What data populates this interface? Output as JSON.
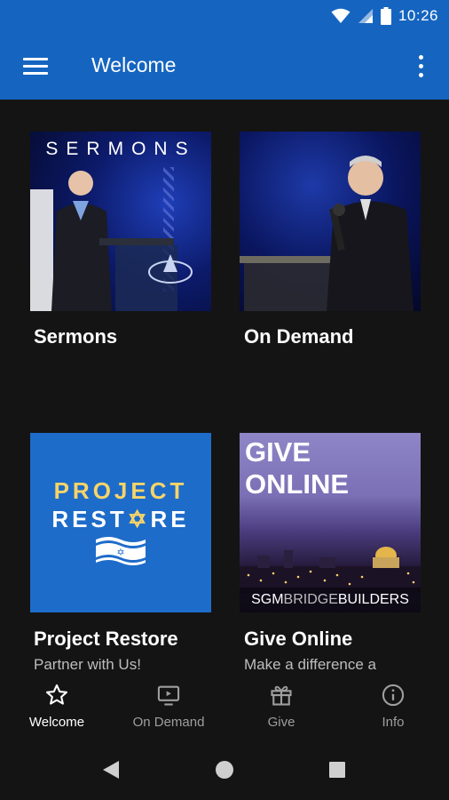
{
  "status": {
    "time": "10:26"
  },
  "appbar": {
    "title": "Welcome"
  },
  "tiles": [
    {
      "title": "Sermons",
      "image_text": "SERMONS"
    },
    {
      "title": "On Demand"
    },
    {
      "title": "Project Restore",
      "subtitle": "Partner with Us!",
      "image_text_line1": "PROJECT",
      "image_text_line2a": "REST",
      "image_text_line2b": "RE"
    },
    {
      "title": "Give Online",
      "subtitle": "Make a difference a",
      "image_text_line1": "GIVE",
      "image_text_line2": "ONLINE",
      "image_brand_a": "SGM",
      "image_brand_b": "BRIDGE",
      "image_brand_c": "BUILDERS"
    }
  ],
  "bottom_nav": [
    {
      "label": "Welcome",
      "icon": "star-icon",
      "active": true
    },
    {
      "label": "On Demand",
      "icon": "tv-icon"
    },
    {
      "label": "Give",
      "icon": "gift-icon"
    },
    {
      "label": "Info",
      "icon": "info-icon"
    }
  ],
  "colors": {
    "primary": "#1565c0",
    "background": "#141414"
  }
}
